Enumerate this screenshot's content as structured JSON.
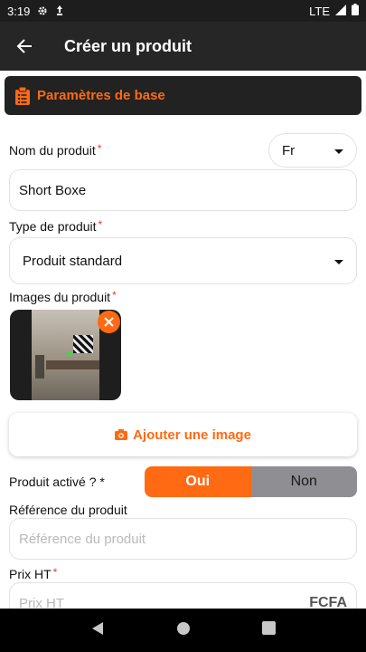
{
  "status": {
    "time": "3:19",
    "network": "LTE"
  },
  "appbar": {
    "title": "Créer un produit"
  },
  "section": {
    "title": "Paramètres de base"
  },
  "product_name": {
    "label": "Nom du produit",
    "required_mark": "*",
    "value": "Short Boxe",
    "language": "Fr"
  },
  "product_type": {
    "label": "Type de produit",
    "required_mark": "*",
    "value": "Produit standard"
  },
  "images": {
    "label": "Images du produit",
    "required_mark": "*",
    "add_label": "Ajouter une image"
  },
  "active": {
    "label": "Produit activé ?",
    "required_mark": "*",
    "yes": "Oui",
    "no": "Non",
    "selected": "Oui"
  },
  "reference": {
    "label": "Référence du produit",
    "placeholder": "Référence du produit"
  },
  "price": {
    "label": "Prix HT",
    "required_mark": "*",
    "placeholder": "Prix HT",
    "currency": "FCFA"
  },
  "colors": {
    "accent": "#ff6a13",
    "appbar": "#262626",
    "section_bg": "#222222"
  }
}
